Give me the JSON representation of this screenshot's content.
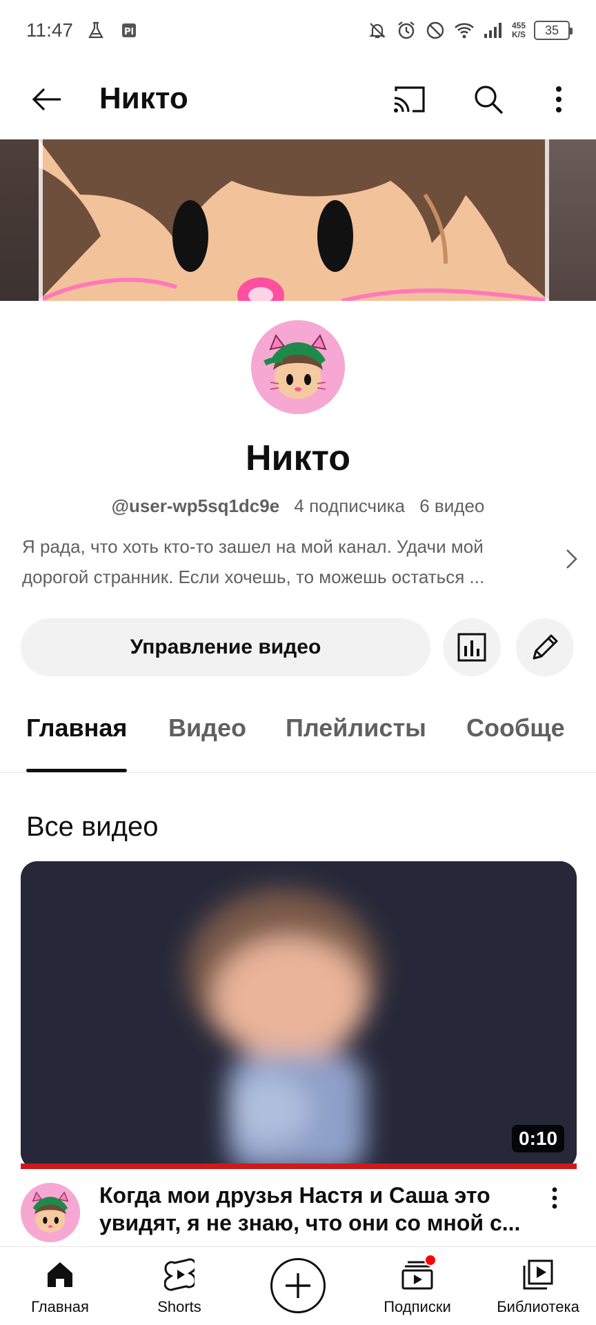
{
  "status_bar": {
    "time": "11:47",
    "net_speed_value": "455",
    "net_speed_unit": "K/S",
    "battery": "35"
  },
  "app_bar": {
    "title": "Никто"
  },
  "channel": {
    "name": "Никто",
    "handle": "@user-wp5sq1dc9e",
    "subscribers": "4 подписчика",
    "videos": "6 видео",
    "description_line1": "Я рада, что хоть кто-то зашел на мой канал. Удачи мой",
    "description_line2": "дорогой странник. Если хочешь, то можешь остаться ..."
  },
  "actions": {
    "manage_label": "Управление видео"
  },
  "tabs": [
    {
      "label": "Главная",
      "active": true
    },
    {
      "label": "Видео",
      "active": false
    },
    {
      "label": "Плейлисты",
      "active": false
    },
    {
      "label": "Сообще",
      "active": false
    }
  ],
  "section": {
    "title": "Все видео"
  },
  "video": {
    "duration": "0:10",
    "title_line1": "Когда мои друзья Настя и Саша это",
    "title_line2": "увидят, я не знаю, что они со мной с...",
    "watched_fraction": 1.0
  },
  "bottom_nav": {
    "home": "Главная",
    "shorts": "Shorts",
    "subscriptions": "Подписки",
    "library": "Библиотека"
  },
  "colors": {
    "accent_red": "#ff0000",
    "progress_red": "#cc1a1a",
    "avatar_pink": "#f6a8d3",
    "text_primary": "#0f0f0f",
    "text_secondary": "#606060",
    "chip_bg": "#f2f2f2"
  },
  "icons": {
    "back": "arrow-left-icon",
    "cast": "cast-icon",
    "search": "search-icon",
    "more": "more-vertical-icon",
    "analytics": "bar-chart-icon",
    "edit": "pencil-icon",
    "home": "home-icon",
    "shorts": "shorts-icon",
    "create": "plus-circle-icon",
    "subscriptions": "subscriptions-icon",
    "library": "library-icon"
  }
}
